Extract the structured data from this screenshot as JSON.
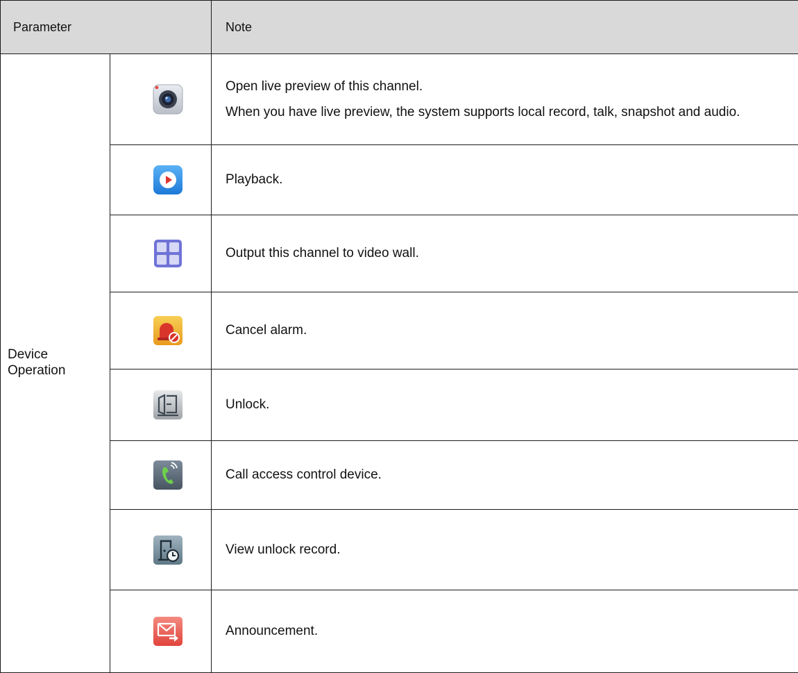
{
  "header": {
    "parameter": "Parameter",
    "note": "Note"
  },
  "group": {
    "line1": "Device",
    "line2": "Operation"
  },
  "rows": [
    {
      "icon": "camera-icon",
      "notes": [
        "Open live preview of this channel.",
        "When you have live preview, the system supports local record, talk, snapshot and audio."
      ]
    },
    {
      "icon": "playback-icon",
      "notes": [
        "Playback."
      ]
    },
    {
      "icon": "video-wall-icon",
      "notes": [
        "Output this channel to video wall."
      ]
    },
    {
      "icon": "cancel-alarm-icon",
      "notes": [
        "Cancel alarm."
      ]
    },
    {
      "icon": "unlock-icon",
      "notes": [
        "Unlock."
      ]
    },
    {
      "icon": "call-icon",
      "notes": [
        "Call access control device."
      ]
    },
    {
      "icon": "unlock-record-icon",
      "notes": [
        "View unlock record."
      ]
    },
    {
      "icon": "announcement-icon",
      "notes": [
        "Announcement."
      ]
    }
  ]
}
